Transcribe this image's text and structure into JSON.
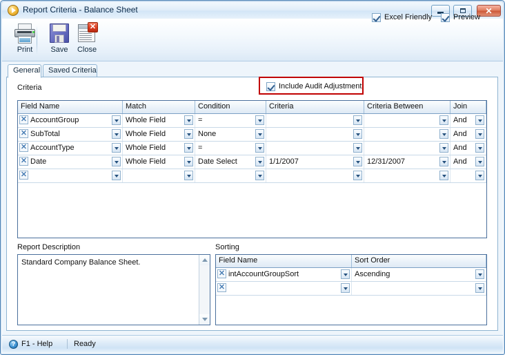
{
  "window": {
    "title": "Report Criteria - Balance Sheet",
    "title_icon": "play-circle-icon",
    "buttons": {
      "minimize": "minimize-icon",
      "maximize": "maximize-icon",
      "close": "✕"
    }
  },
  "toolbar": {
    "items": [
      {
        "label": "Print",
        "icon": "printer-icon"
      },
      {
        "label": "Save",
        "icon": "floppy-disk-icon"
      },
      {
        "label": "Close",
        "icon": "document-close-icon"
      }
    ]
  },
  "tabs": [
    {
      "label": "General",
      "active": true
    },
    {
      "label": "Saved Criteria",
      "active": false
    }
  ],
  "options": {
    "include_audit_adjustment": {
      "label": "Include Audit Adjustment",
      "checked": true
    },
    "excel_friendly": {
      "label": "Excel Friendly",
      "checked": true
    },
    "preview": {
      "label": "Preview",
      "checked": true
    }
  },
  "criteria_section": {
    "label": "Criteria",
    "columns": [
      "Field Name",
      "Match",
      "Condition",
      "Criteria",
      "Criteria Between",
      "Join"
    ],
    "rows": [
      {
        "field_name": "AccountGroup",
        "match": "Whole Field",
        "condition": "=",
        "criteria": "",
        "criteria_between": "",
        "join": "And"
      },
      {
        "field_name": "SubTotal",
        "match": "Whole Field",
        "condition": "None",
        "criteria": "",
        "criteria_between": "",
        "join": "And"
      },
      {
        "field_name": "AccountType",
        "match": "Whole Field",
        "condition": "=",
        "criteria": "",
        "criteria_between": "",
        "join": "And"
      },
      {
        "field_name": "Date",
        "match": "Whole Field",
        "condition": "Date Select",
        "criteria": "1/1/2007",
        "criteria_between": "12/31/2007",
        "join": "And"
      },
      {
        "field_name": "",
        "match": "",
        "condition": "",
        "criteria": "",
        "criteria_between": "",
        "join": ""
      }
    ]
  },
  "report_description": {
    "label": "Report Description",
    "value": "Standard Company Balance Sheet."
  },
  "sorting_section": {
    "label": "Sorting",
    "columns": [
      "Field Name",
      "Sort Order"
    ],
    "rows": [
      {
        "field_name": "intAccountGroupSort",
        "sort_order": "Ascending"
      },
      {
        "field_name": "",
        "sort_order": ""
      }
    ]
  },
  "statusbar": {
    "help_icon": "help-circle-icon",
    "help_label": "F1 - Help",
    "status": "Ready"
  },
  "colors": {
    "highlight_box": "#c00000",
    "window_border": "#5a8ab8",
    "grid_border": "#4a6f9c",
    "close_button": "#cd5a39"
  }
}
